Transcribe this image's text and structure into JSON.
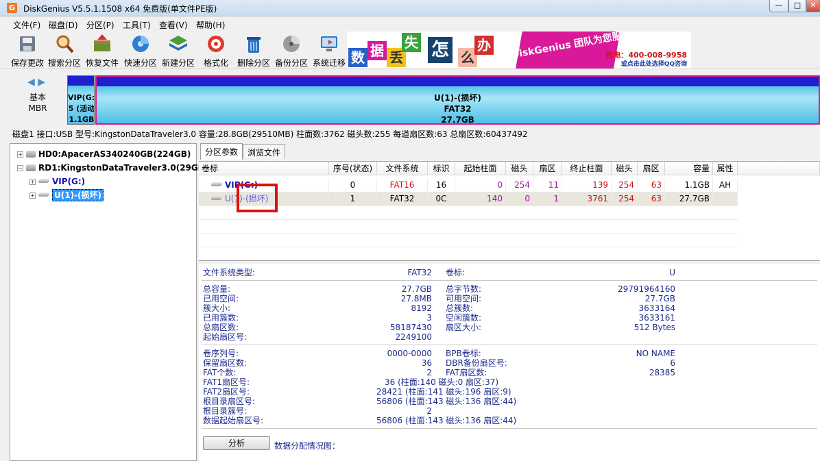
{
  "window": {
    "title": "DiskGenius V5.5.1.1508 x64 免费版(单文件PE版)",
    "app_icon_letter": "G",
    "minimize": "—",
    "maximize": "□",
    "close": "✕"
  },
  "menu": [
    "文件(F)",
    "磁盘(D)",
    "分区(P)",
    "工具(T)",
    "查看(V)",
    "帮助(H)"
  ],
  "toolbar": [
    {
      "label": "保存更改",
      "icon": "save-icon"
    },
    {
      "label": "搜索分区",
      "icon": "search-partition-icon"
    },
    {
      "label": "恢复文件",
      "icon": "recover-file-icon"
    },
    {
      "label": "快速分区",
      "icon": "quick-partition-icon"
    },
    {
      "label": "新建分区",
      "icon": "new-partition-icon"
    },
    {
      "label": "格式化",
      "icon": "format-icon"
    },
    {
      "label": "删除分区",
      "icon": "delete-partition-icon"
    },
    {
      "label": "备份分区",
      "icon": "backup-partition-icon"
    },
    {
      "label": "系统迁移",
      "icon": "system-migrate-icon"
    }
  ],
  "banner": {
    "chars": [
      "数",
      "据",
      "丢",
      "失",
      "怎",
      "么",
      "办"
    ],
    "slogan": "DiskGenius 团队为您服务",
    "phone": "致电：400-008-9958",
    "qq": "或点击此处选择QQ咨询"
  },
  "diskmap": {
    "disk_type_line1": "基本",
    "disk_type_line2": "MBR",
    "nav": "◀ ▶",
    "vip": {
      "l1": "VIP(G:)",
      "l2": "5 (活动",
      "l3": "1.1GB"
    },
    "u": {
      "l1": "U(1)-(损坏)",
      "l2": "FAT32",
      "l3": "27.7GB"
    }
  },
  "disk_info": "磁盘1 接口:USB  型号:KingstonDataTraveler3.0  容量:28.8GB(29510MB)  柱面数:3762  磁头数:255  每道扇区数:63  总扇区数:60437492",
  "tree": {
    "hd0": "HD0:ApacerAS340240GB(224GB)",
    "rd1": "RD1:KingstonDataTraveler3.0(29GB)",
    "vip": "VIP(G:)",
    "u": "U(1)-(损坏)"
  },
  "tabs": [
    "分区参数",
    "浏览文件"
  ],
  "partition_table": {
    "headers": [
      "卷标",
      "序号(状态)",
      "文件系统",
      "标识",
      "起始柱面",
      "磁头",
      "扇区",
      "终止柱面",
      "磁头",
      "扇区",
      "容量",
      "属性"
    ],
    "rows": [
      [
        "VIP(G:)",
        "0",
        "FAT16",
        "16",
        "0",
        "254",
        "11",
        "139",
        "254",
        "63",
        "1.1GB",
        "AH"
      ],
      [
        "U(1)-(损坏)",
        "1",
        "FAT32",
        "0C",
        "140",
        "0",
        "1",
        "3761",
        "254",
        "63",
        "27.7GB",
        ""
      ]
    ]
  },
  "fs_info": {
    "fs_type_label": "文件系统类型:",
    "fs_type": "FAT32",
    "vol_label_label": "卷标:",
    "vol_label": "U",
    "left_labels": [
      "总容量:",
      "已用空间:",
      "簇大小:",
      "已用簇数:",
      "总扇区数:",
      "起始扇区号:"
    ],
    "left_values": [
      "27.7GB",
      "27.8MB",
      "8192",
      "3",
      "58187430",
      "2249100"
    ],
    "right_labels": [
      "总字节数:",
      "可用空间:",
      "总簇数:",
      "空闲簇数:",
      "扇区大小:"
    ],
    "right_values": [
      "29791964160",
      "27.7GB",
      "3633164",
      "3633161",
      "512 Bytes"
    ],
    "b_labels": [
      "卷序列号:",
      "保留扇区数:",
      "FAT个数:",
      "FAT1扇区号:",
      "FAT2扇区号:",
      "根目录扇区号:",
      "根目录簇号:",
      "数据起始扇区号:"
    ],
    "b_values": [
      "0000-0000",
      "36",
      "2",
      "36 (柱面:140 磁头:0 扇区:37)",
      "28421 (柱面:141 磁头:196 扇区:9)",
      "56806 (柱面:143 磁头:136 扇区:44)",
      "2",
      "56806 (柱面:143 磁头:136 扇区:44)"
    ],
    "br_labels": [
      "BPB卷标:",
      "DBR备份扇区号:",
      "FAT扇区数:"
    ],
    "br_values": [
      "NO NAME",
      "6",
      "28385"
    ]
  },
  "analyze_button": "分析",
  "distribution_label": "数据分配情况图："
}
